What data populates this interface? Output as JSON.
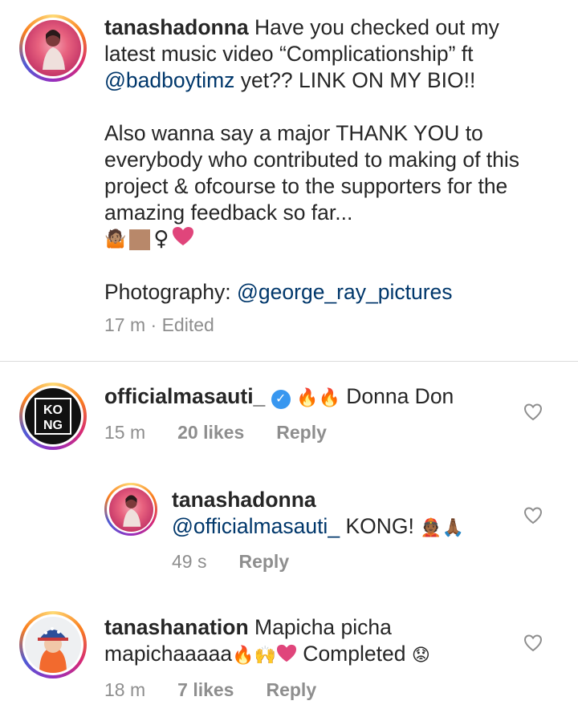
{
  "post": {
    "username": "tanashadonna",
    "line1_text": " Have you checked out my latest music video “Complicationship” ft ",
    "mention1": "@badboytimz",
    "line1_after": " yet?? LINK ON MY BIO!!",
    "paragraph2": "Also wanna say a major THANK YOU to everybody who contributed to making of this project & ofcourse to the supporters for the amazing feedback so far...",
    "emoji_line": "🤷🏽‍♀️❤",
    "photo_label": "Photography: ",
    "photo_mention": "@george_ray_pictures",
    "meta": "17 m · Edited"
  },
  "comments": [
    {
      "username": "officialmasauti_",
      "text": "Donna Don",
      "time": "15 m",
      "likes": "20 likes",
      "reply": "Reply",
      "avatar_text": "KO NG"
    },
    {
      "username": "tanashadonna",
      "mention": "@officialmasauti_",
      "text": " KONG! ",
      "time": "49 s",
      "reply": "Reply"
    },
    {
      "username": "tanashanation",
      "text": " Mapicha picha mapichaaaaa",
      "text_after": " Completed ",
      "time": "18 m",
      "likes": "7 likes",
      "reply": "Reply"
    }
  ],
  "colors": {
    "mention": "#00376b",
    "meta": "#8e8e8e",
    "divider": "#dbdbdb",
    "verified": "#3897f0",
    "heart_emoji": "#e0457b"
  },
  "icons": [
    "heart-outline-icon",
    "verified-badge-icon",
    "fire-emoji",
    "raised-hands-emoji",
    "heart-emoji",
    "crown-face-emoji",
    "praying-hands-emoji",
    "worried-face-emoji"
  ]
}
